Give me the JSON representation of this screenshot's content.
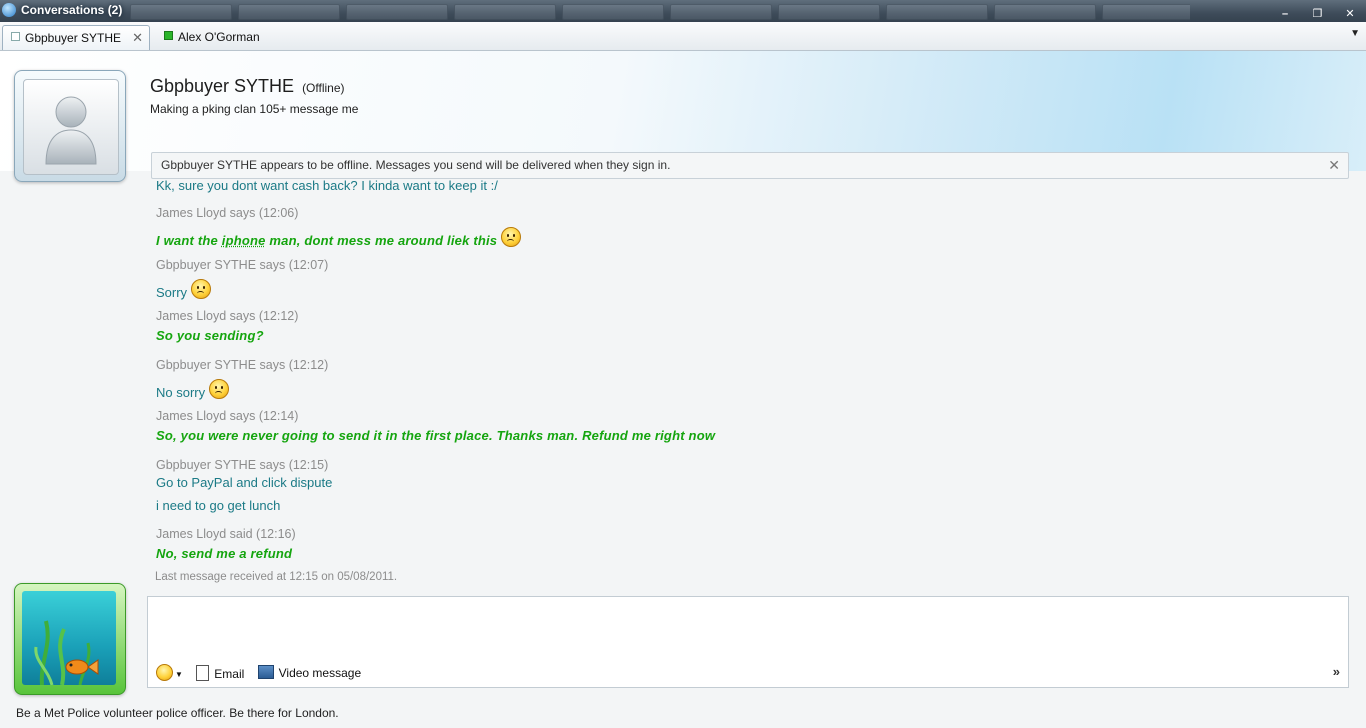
{
  "window": {
    "title": "Conversations (2)",
    "controls": [
      "minimize-icon",
      "restore-icon",
      "close-icon"
    ]
  },
  "tabs": [
    {
      "label": "Gbpbuyer SYTHE",
      "active": true
    },
    {
      "label": "Alex O'Gorman",
      "active": false,
      "presence_color": "#2ab52a"
    }
  ],
  "contact": {
    "name": "Gbpbuyer SYTHE",
    "status": "(Offline)",
    "personal_message": "Making a pking clan 105+ message me"
  },
  "offline_notice": "Gbpbuyer SYTHE appears to be offline. Messages you send will be delivered when they sign in.",
  "conversation": [
    {
      "type": "them",
      "text": "Kk, sure you dont want cash back? I kinda want to keep it :/"
    },
    {
      "type": "header",
      "text": "James Lloyd says (12:06)"
    },
    {
      "type": "me",
      "pre": "I want the ",
      "underlined": "iphone",
      "post": " man, dont  mess  me around liek this",
      "emoticon": "sad-emoticon"
    },
    {
      "type": "header",
      "text": "Gbpbuyer SYTHE says (12:07)"
    },
    {
      "type": "them",
      "text": "Sorry",
      "emoticon": "sad-emoticon"
    },
    {
      "type": "header",
      "text": "James Lloyd says (12:12)"
    },
    {
      "type": "me",
      "text": "So you sending?"
    },
    {
      "type": "header",
      "text": "Gbpbuyer SYTHE says (12:12)"
    },
    {
      "type": "them",
      "text": "No sorry",
      "emoticon": "sad-emoticon"
    },
    {
      "type": "header",
      "text": "James Lloyd says (12:14)"
    },
    {
      "type": "me",
      "text": "So, you were never going to send it in the first place. Thanks  man. Refund  me right  now"
    },
    {
      "type": "header",
      "text": "Gbpbuyer SYTHE says (12:15)"
    },
    {
      "type": "them",
      "text": "Go to PayPal and click dispute"
    },
    {
      "type": "them",
      "text": "i need to go get lunch"
    },
    {
      "type": "header",
      "text": "James Lloyd said (12:16)"
    },
    {
      "type": "me",
      "text": "No, send  me a refund"
    },
    {
      "type": "footer",
      "text": "Last message received at 12:15 on 05/08/2011."
    }
  ],
  "compose": {
    "toolbar": {
      "emoticon_icon": "emoticon-icon",
      "email_label": "Email",
      "video_label": "Video message"
    },
    "expand_label": "»"
  },
  "footer_ad": "Be a Met Police volunteer police officer. Be there for London.",
  "colors": {
    "them_text": "#1b7a86",
    "me_text": "#15a50f",
    "header_text": "#8c8c8c"
  }
}
